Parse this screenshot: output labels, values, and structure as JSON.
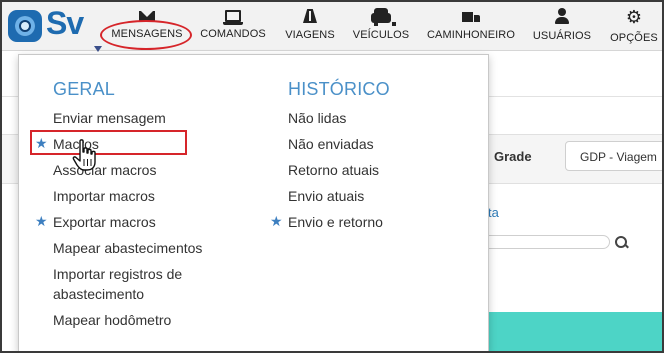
{
  "logo": {
    "text": "Sv"
  },
  "nav": [
    {
      "label": "MENSAGENS",
      "icon": "envelope-icon"
    },
    {
      "label": "COMANDOS",
      "icon": "laptop-icon"
    },
    {
      "label": "VIAGENS",
      "icon": "road-icon"
    },
    {
      "label": "VEÍCULOS",
      "icon": "car-icon"
    },
    {
      "label": "CAMINHONEIRO",
      "icon": "truck-icon"
    },
    {
      "label": "USUÁRIOS",
      "icon": "user-icon"
    },
    {
      "label": "OPÇÕES",
      "icon": "cogs-icon"
    }
  ],
  "background": {
    "grade_label": "Grade",
    "select_value": "GDP - Viagem",
    "link_fragment": "ta"
  },
  "dropdown": {
    "geral": {
      "title": "GERAL",
      "items": [
        {
          "label": "Enviar mensagem",
          "starred": false
        },
        {
          "label": "Macros",
          "starred": true
        },
        {
          "label": "Associar macros",
          "starred": false
        },
        {
          "label": "Importar macros",
          "starred": false
        },
        {
          "label": "Exportar macros",
          "starred": true
        },
        {
          "label": "Mapear abastecimentos",
          "starred": false
        },
        {
          "label": "Importar registros de",
          "starred": false
        },
        {
          "label": "abastecimento",
          "starred": false
        },
        {
          "label": "Mapear hodômetro",
          "starred": false
        }
      ]
    },
    "historico": {
      "title": "HISTÓRICO",
      "items": [
        {
          "label": "Não lidas",
          "starred": false
        },
        {
          "label": "Não enviadas",
          "starred": false
        },
        {
          "label": "Retorno atuais",
          "starred": false
        },
        {
          "label": "Envio atuais",
          "starred": false
        },
        {
          "label": "Envio e retorno",
          "starred": true
        }
      ]
    }
  },
  "colors": {
    "accent": "#4a90c8",
    "highlight": "#d6252a",
    "logo": "#1e6bb0",
    "teal": "#4dd4c6"
  }
}
